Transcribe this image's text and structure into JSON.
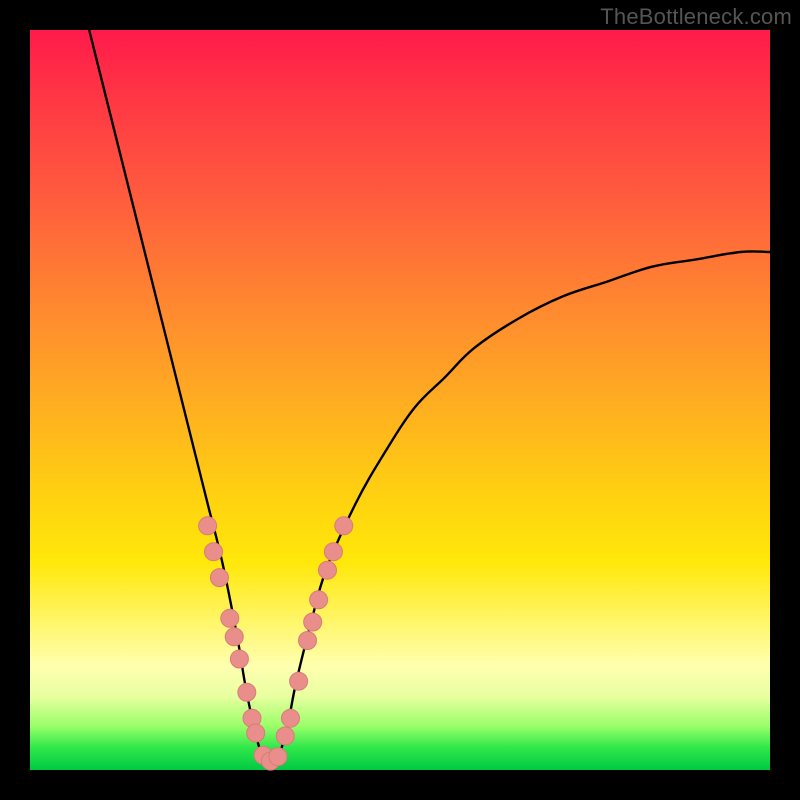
{
  "watermark": "TheBottleneck.com",
  "colors": {
    "curve_stroke": "#000000",
    "marker_fill": "#e98e8a",
    "marker_stroke": "#d77c77",
    "background_black": "#000000"
  },
  "chart_data": {
    "type": "line",
    "title": "",
    "xlabel": "",
    "ylabel": "",
    "xlim": [
      0,
      100
    ],
    "ylim": [
      0,
      100
    ],
    "grid": false,
    "legend": false,
    "series": [
      {
        "name": "bottleneck-curve",
        "note": "V-shaped curve; y≈100 at left, dips to ~1 near x≈32, rises back toward ~70 at x=100",
        "x": [
          8,
          10,
          12,
          14,
          16,
          18,
          20,
          22,
          24,
          26,
          28,
          29,
          30,
          31,
          32,
          33,
          34,
          35,
          36,
          38,
          40,
          44,
          48,
          52,
          56,
          60,
          66,
          72,
          78,
          84,
          90,
          96,
          100
        ],
        "y": [
          100,
          92,
          84,
          76,
          68,
          60,
          52,
          44,
          36,
          28,
          18,
          12,
          7,
          3,
          1,
          1,
          3,
          7,
          12,
          20,
          27,
          36,
          43,
          49,
          53,
          57,
          61,
          64,
          66,
          68,
          69,
          70,
          70
        ]
      }
    ],
    "markers": {
      "name": "highlighted-points",
      "note": "salmon dots clustered near the bottom of the V",
      "points": [
        {
          "x": 24.0,
          "y": 33.0
        },
        {
          "x": 24.8,
          "y": 29.5
        },
        {
          "x": 25.6,
          "y": 26.0
        },
        {
          "x": 27.0,
          "y": 20.5
        },
        {
          "x": 27.6,
          "y": 18.0
        },
        {
          "x": 28.3,
          "y": 15.0
        },
        {
          "x": 29.3,
          "y": 10.5
        },
        {
          "x": 30.0,
          "y": 7.0
        },
        {
          "x": 30.5,
          "y": 5.0
        },
        {
          "x": 31.5,
          "y": 2.0
        },
        {
          "x": 32.5,
          "y": 1.2
        },
        {
          "x": 33.5,
          "y": 1.8
        },
        {
          "x": 34.5,
          "y": 4.6
        },
        {
          "x": 35.2,
          "y": 7.0
        },
        {
          "x": 36.3,
          "y": 12.0
        },
        {
          "x": 37.5,
          "y": 17.5
        },
        {
          "x": 38.2,
          "y": 20.0
        },
        {
          "x": 39.0,
          "y": 23.0
        },
        {
          "x": 40.2,
          "y": 27.0
        },
        {
          "x": 41.0,
          "y": 29.5
        },
        {
          "x": 42.4,
          "y": 33.0
        }
      ]
    }
  }
}
